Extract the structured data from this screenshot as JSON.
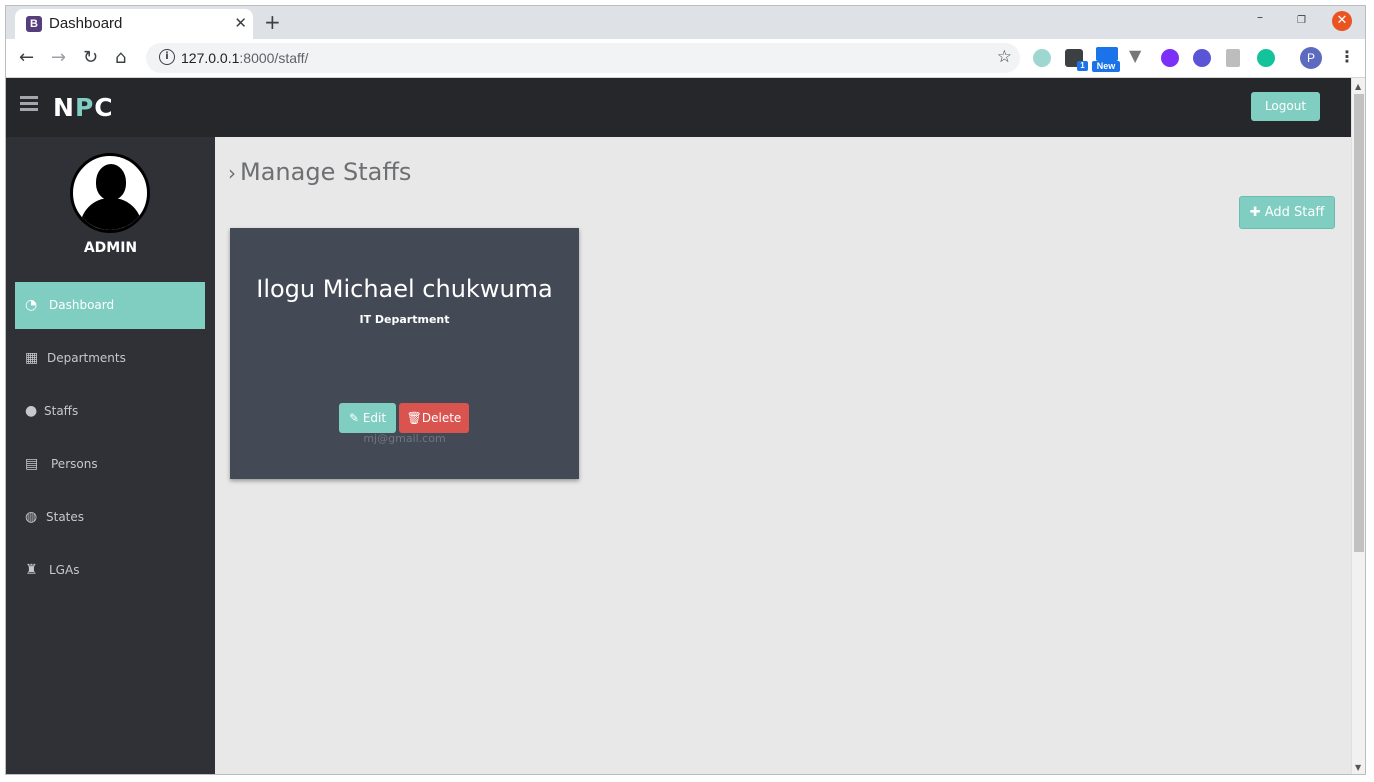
{
  "browser": {
    "tab_title": "Dashboard",
    "tab_favicon": "B",
    "url_host": "127.0.0.1",
    "url_rest": ":8000/staff/",
    "ext_badge_count": "1",
    "ext_new_label": "New",
    "profile_initial": "P"
  },
  "app": {
    "brand_left": "N",
    "brand_accent": "P",
    "brand_right": "C",
    "logout_label": "Logout",
    "accent_color": "#7fcec1"
  },
  "sidebar": {
    "user_label": "ADMIN",
    "items": [
      {
        "label": "Dashboard",
        "icon": "tachometer-icon",
        "active": true
      },
      {
        "label": "Departments",
        "icon": "building-icon",
        "active": false
      },
      {
        "label": "Staffs",
        "icon": "user-icon",
        "active": false
      },
      {
        "label": "Persons",
        "icon": "id-card-icon",
        "active": false
      },
      {
        "label": "States",
        "icon": "globe-icon",
        "active": false
      },
      {
        "label": "LGAs",
        "icon": "castle-icon",
        "active": false
      }
    ]
  },
  "main": {
    "page_title": "Manage Staffs",
    "add_button_label": "Add Staff",
    "staff": [
      {
        "name": "Ilogu Michael chukwuma",
        "department": "IT Department",
        "email": "mj@gmail.com",
        "edit_label": "Edit",
        "delete_label": "Delete"
      }
    ]
  }
}
